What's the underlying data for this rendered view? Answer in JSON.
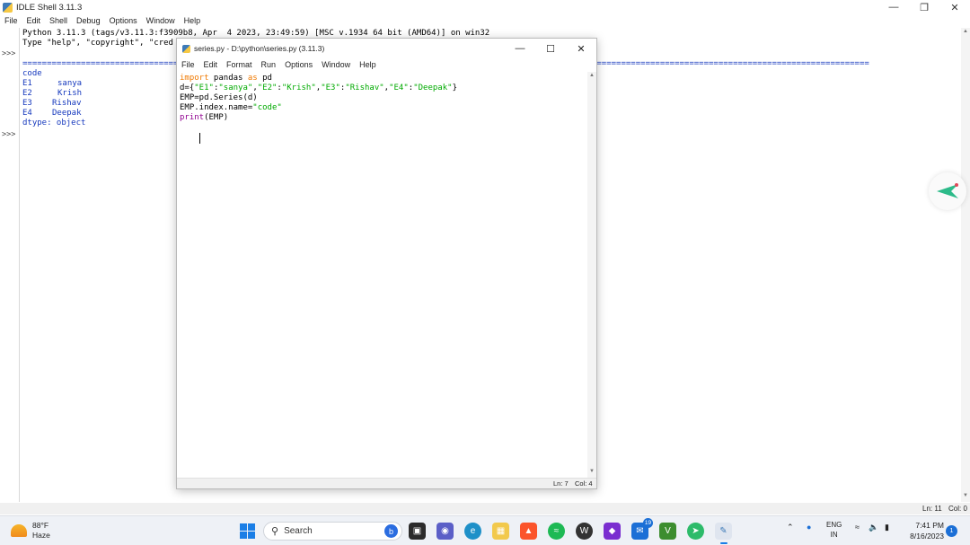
{
  "shell": {
    "title": "IDLE Shell 3.11.3",
    "menu": [
      "File",
      "Edit",
      "Shell",
      "Debug",
      "Options",
      "Window",
      "Help"
    ],
    "prompts": [
      ">>>",
      ">>>"
    ],
    "banner_line1": "Python 3.11.3 (tags/v3.11.3:f3909b8, Apr  4 2023, 23:49:59) [MSC v.1934 64 bit (AMD64)] on win32",
    "banner_line2": "Type \"help\", \"copyright\", \"cred",
    "separator": "==============================================================================================================================================================================",
    "output": {
      "header": "code",
      "rows": [
        {
          "key": "E1",
          "value": "sanya"
        },
        {
          "key": "E2",
          "value": "Krish"
        },
        {
          "key": "E3",
          "value": "Rishav"
        },
        {
          "key": "E4",
          "value": "Deepak"
        }
      ],
      "dtype": "dtype: object"
    },
    "status": {
      "ln": "Ln: 11",
      "col": "Col: 0"
    }
  },
  "editor": {
    "title": "series.py - D:\\python\\series.py (3.11.3)",
    "menu": [
      "File",
      "Edit",
      "Format",
      "Run",
      "Options",
      "Window",
      "Help"
    ],
    "code": {
      "l1_kw1": "import",
      "l1_mid": " pandas ",
      "l1_kw2": "as",
      "l1_end": " pd",
      "l2_pre": "d={",
      "l2_s1": "\"E1\"",
      "l2_s2": "\"sanya\"",
      "l2_s3": "\"E2\"",
      "l2_s4": "\"Krish\"",
      "l2_s5": "\"E3\"",
      "l2_s6": "\"Rishav\"",
      "l2_s7": "\"E4\"",
      "l2_s8": "\"Deepak\"",
      "l2_end": "}",
      "l3": "EMP=pd.Series(d)",
      "l4_pre": "EMP.index.name=",
      "l4_str": "\"code\"",
      "l5_bi": "print",
      "l5_end": "(EMP)"
    },
    "status": {
      "ln": "Ln: 7",
      "col": "Col: 4"
    }
  },
  "taskbar": {
    "weather": {
      "temp": "88°F",
      "condition": "Haze"
    },
    "search_placeholder": "Search",
    "badge_count": "19",
    "tray": {
      "lang": "ENG",
      "region": "IN"
    },
    "clock": {
      "time": "7:41 PM",
      "date": "8/16/2023"
    },
    "notification_count": "1"
  }
}
